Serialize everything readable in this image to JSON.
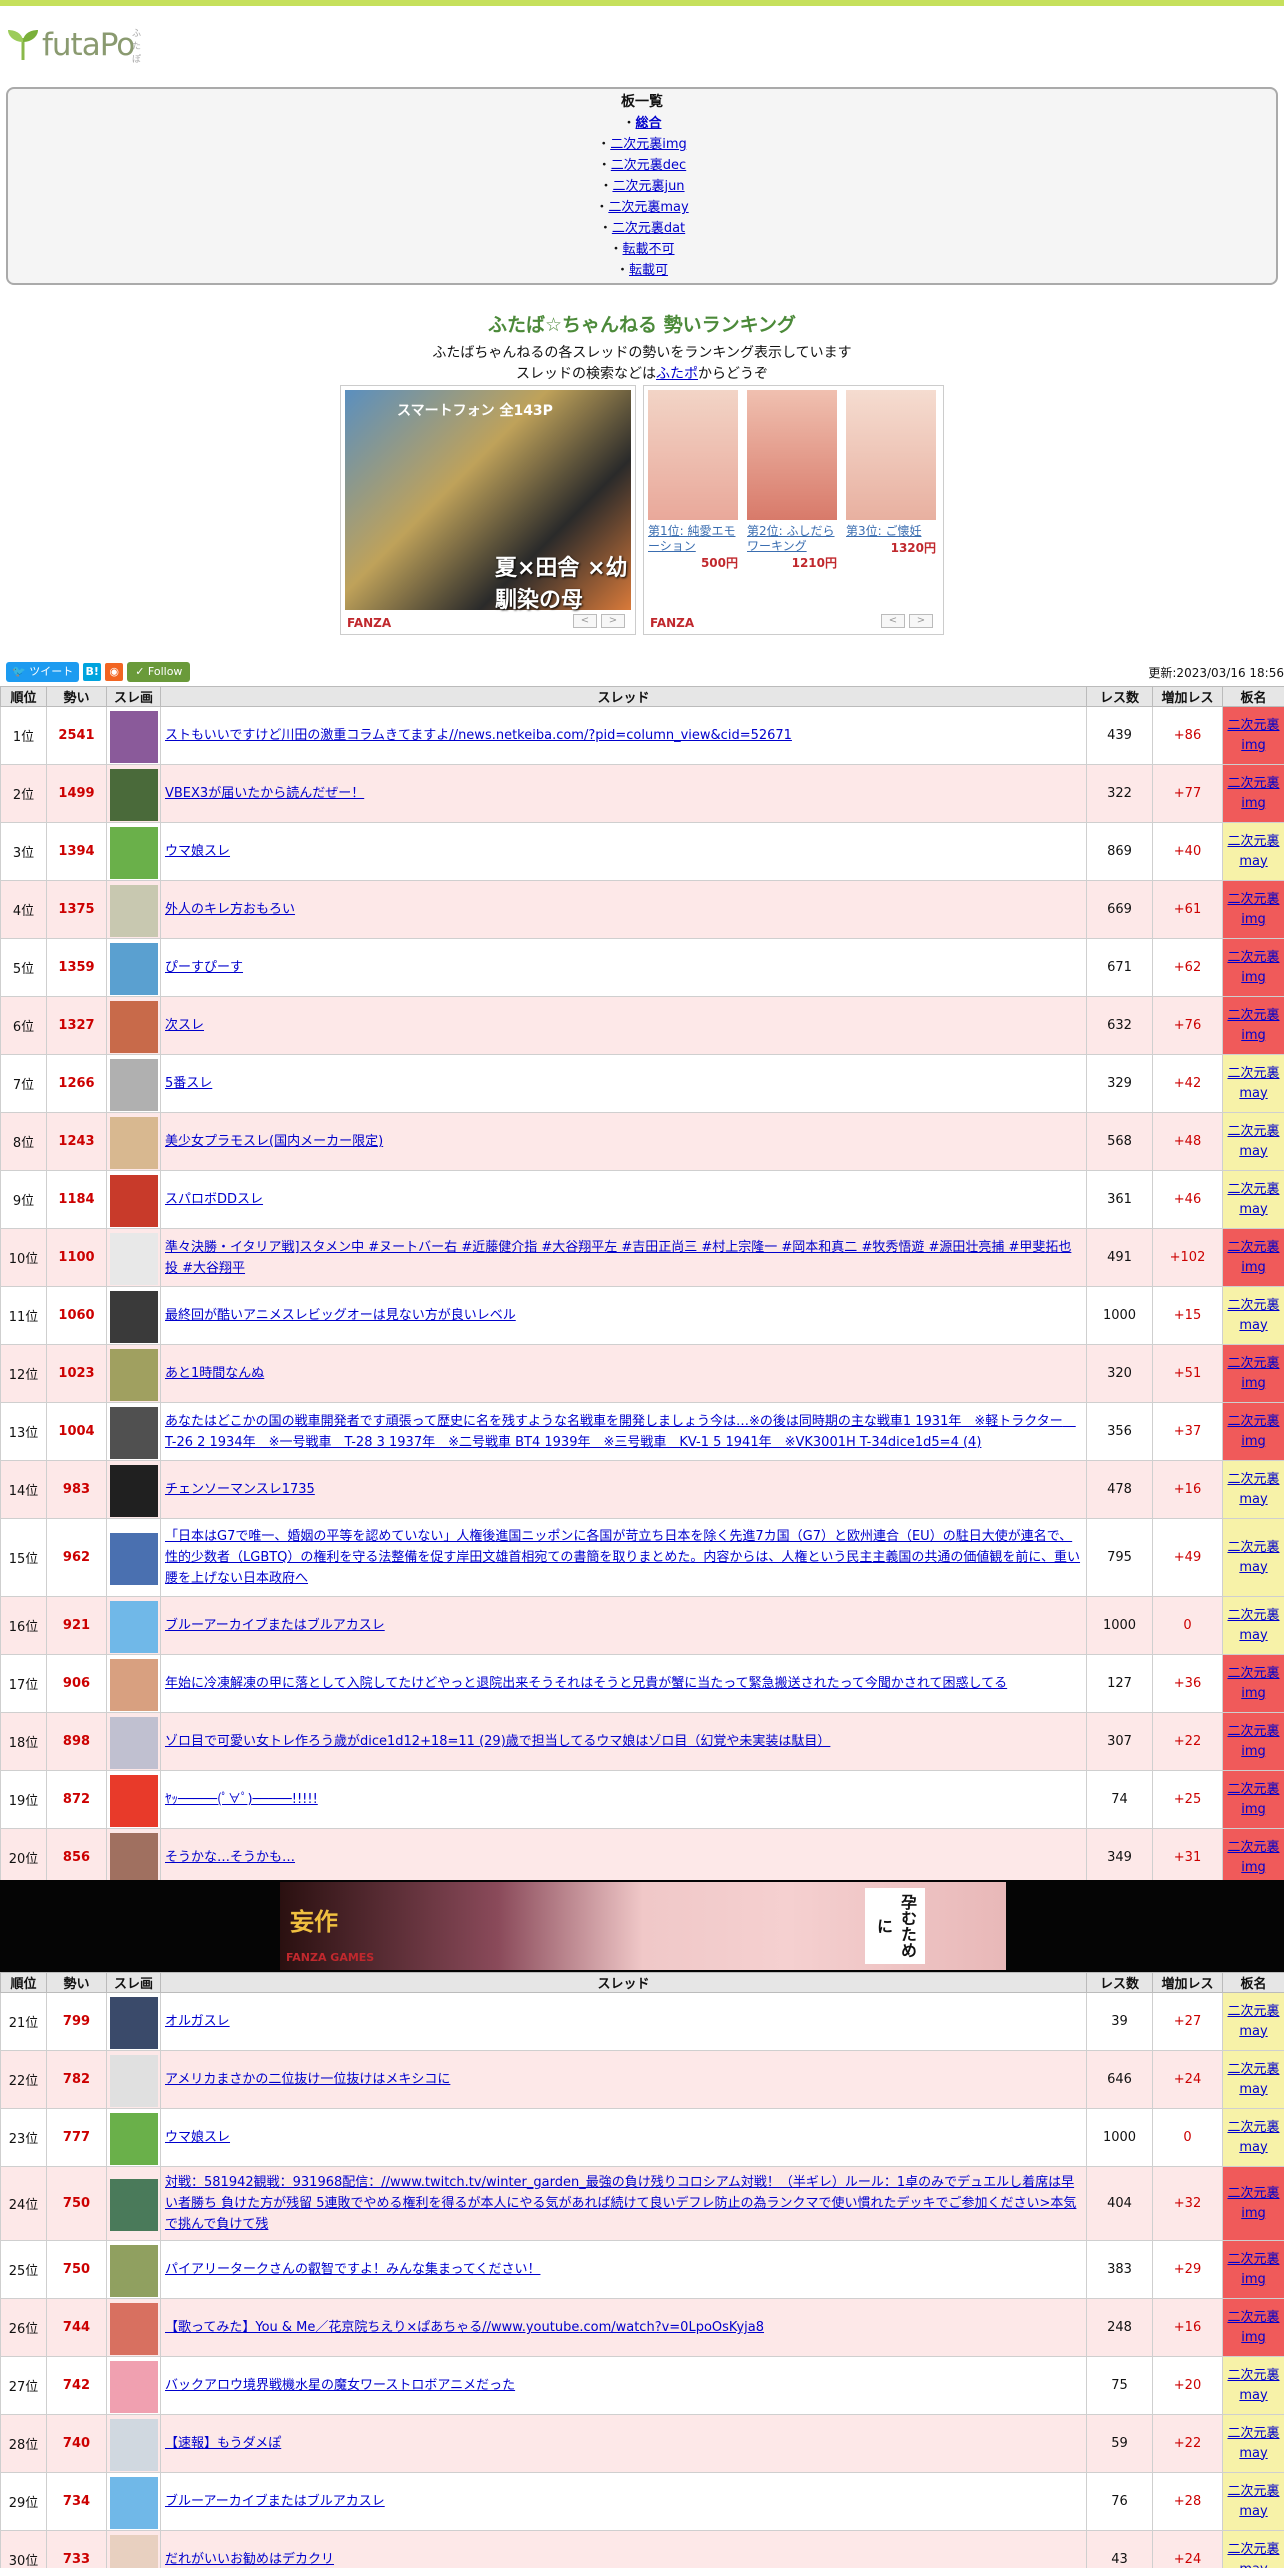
{
  "logo": {
    "text": "futaPo",
    "ruby": "ふたぽ"
  },
  "boards": {
    "title": "板一覧",
    "items": [
      {
        "label": "総合"
      },
      {
        "label": "二次元裏img"
      },
      {
        "label": "二次元裏dec"
      },
      {
        "label": "二次元裏jun"
      },
      {
        "label": "二次元裏may"
      },
      {
        "label": "二次元裏dat"
      },
      {
        "label": "転載不可"
      },
      {
        "label": "転載可"
      }
    ]
  },
  "heading": {
    "title": "ふたば☆ちゃんねる 勢いランキング",
    "line1": "ふたばちゃんねるの各スレッドの勢いをランキング表示しています",
    "line2_pre": "スレッドの検索などは",
    "line2_link": "ふたポ",
    "line2_post": "からどうぞ"
  },
  "ad1": {
    "banner_top": "スマートフォン 全143P",
    "banner_text": "夏×田舎 ×幼馴染の母",
    "brand": "FANZA",
    "prev": "<",
    "next": ">"
  },
  "ad2": {
    "brand": "FANZA",
    "prev": "<",
    "next": ">",
    "products": [
      {
        "name": "第1位: 純愛エモーション",
        "price": "500円"
      },
      {
        "name": "第2位: ふしだらワーキング",
        "price": "1210円"
      },
      {
        "name": "第3位: ご懐妊",
        "price": "1320円"
      }
    ]
  },
  "social": {
    "tweet": "ツイート",
    "hatena": "B!",
    "rss": "RSS",
    "follow": "Follow"
  },
  "updated": "更新:2023/03/16 18:56",
  "table_headers": {
    "rank": "順位",
    "ikioi": "勢い",
    "img": "スレ画",
    "thread": "スレッド",
    "res": "レス数",
    "add": "増加レス",
    "board": "板名"
  },
  "rows1": [
    {
      "rank": "1位",
      "ikioi": "2541",
      "thread": "ストもいいですけど川田の激重コラムきてますよ//news.netkeiba.com/?pid=column_view&cid=52671",
      "res": "439",
      "add": "+86",
      "board1": "二次元裏",
      "board2": "img",
      "color": "#8a5a9a"
    },
    {
      "rank": "2位",
      "ikioi": "1499",
      "thread": "VBEX3が届いたから読んだぜー！",
      "res": "322",
      "add": "+77",
      "board1": "二次元裏",
      "board2": "img",
      "color": "#4a6a3a"
    },
    {
      "rank": "3位",
      "ikioi": "1394",
      "thread": "ウマ娘スレ",
      "res": "869",
      "add": "+40",
      "board1": "二次元裏",
      "board2": "may",
      "color": "#6ab04a"
    },
    {
      "rank": "4位",
      "ikioi": "1375",
      "thread": "外人のキレ方おもろい",
      "res": "669",
      "add": "+61",
      "board1": "二次元裏",
      "board2": "img",
      "color": "#c8c8b0"
    },
    {
      "rank": "5位",
      "ikioi": "1359",
      "thread": "ぴーすぴーす",
      "res": "671",
      "add": "+62",
      "board1": "二次元裏",
      "board2": "img",
      "color": "#5aa0d0"
    },
    {
      "rank": "6位",
      "ikioi": "1327",
      "thread": "次スレ",
      "res": "632",
      "add": "+76",
      "board1": "二次元裏",
      "board2": "img",
      "color": "#c86a4a"
    },
    {
      "rank": "7位",
      "ikioi": "1266",
      "thread": "5番スレ",
      "res": "329",
      "add": "+42",
      "board1": "二次元裏",
      "board2": "may",
      "color": "#b0b0b0"
    },
    {
      "rank": "8位",
      "ikioi": "1243",
      "thread": "美少女プラモスレ(国内メーカー限定)",
      "res": "568",
      "add": "+48",
      "board1": "二次元裏",
      "board2": "may",
      "color": "#d8b890"
    },
    {
      "rank": "9位",
      "ikioi": "1184",
      "thread": "スパロボDDスレ",
      "res": "361",
      "add": "+46",
      "board1": "二次元裏",
      "board2": "may",
      "color": "#c83a2a"
    },
    {
      "rank": "10位",
      "ikioi": "1100",
      "thread": "準々決勝・イタリア戦]スタメン中 #ヌートバー右 #近藤健介指 #大谷翔平左 #吉田正尚三 #村上宗隆一 #岡本和真二 #牧秀悟遊 #源田壮亮捕 #甲斐拓也投 #大谷翔平",
      "res": "491",
      "add": "+102",
      "board1": "二次元裏",
      "board2": "img",
      "color": "#e8e8e8"
    },
    {
      "rank": "11位",
      "ikioi": "1060",
      "thread": "最終回が酷いアニメスレビッグオーは見ない方が良いレベル",
      "res": "1000",
      "add": "+15",
      "board1": "二次元裏",
      "board2": "may",
      "color": "#3a3a3a"
    },
    {
      "rank": "12位",
      "ikioi": "1023",
      "thread": "あと1時間なんぬ",
      "res": "320",
      "add": "+51",
      "board1": "二次元裏",
      "board2": "img",
      "color": "#a0a060"
    },
    {
      "rank": "13位",
      "ikioi": "1004",
      "thread": "あなたはどこかの国の戦車開発者です頑張って歴史に名を残すような名戦車を開発しましょう今は…※の後は同時期の主な戦車1 1931年　※軽トラクター　T-26 2 1934年　※一号戦車　T-28 3 1937年　※二号戦車 BT4 1939年　※三号戦車　KV-1 5 1941年　※VK3001H T-34dice1d5=4 (4)",
      "res": "356",
      "add": "+37",
      "board1": "二次元裏",
      "board2": "img",
      "color": "#505050"
    },
    {
      "rank": "14位",
      "ikioi": "983",
      "thread": "チェンソーマンスレ1735",
      "res": "478",
      "add": "+16",
      "board1": "二次元裏",
      "board2": "may",
      "color": "#202020"
    },
    {
      "rank": "15位",
      "ikioi": "962",
      "thread": "「日本はG7で唯一、婚姻の平等を認めていない」人権後進国ニッポンに各国が苛立ち日本を除く先進7カ国（G7）と欧州連合（EU）の駐日大使が連名で、性的少数者（LGBTQ）の権利を守る法整備を促す岸田文雄首相宛ての書簡を取りまとめた。内容からは、人権という民主主義国の共通の価値観を前に、重い腰を上げない日本政府へ",
      "res": "795",
      "add": "+49",
      "board1": "二次元裏",
      "board2": "may",
      "color": "#4a70b0"
    },
    {
      "rank": "16位",
      "ikioi": "921",
      "thread": "ブルーアーカイブまたはブルアカスレ",
      "res": "1000",
      "add": "0",
      "board1": "二次元裏",
      "board2": "may",
      "color": "#70b8e8"
    },
    {
      "rank": "17位",
      "ikioi": "906",
      "thread": "年始に冷凍解凍の甲に落として入院してたけどやっと退院出来そうそれはそうと兄貴が蟹に当たって緊急搬送されたって今聞かされて困惑してる",
      "res": "127",
      "add": "+36",
      "board1": "二次元裏",
      "board2": "img",
      "color": "#d8a080"
    },
    {
      "rank": "18位",
      "ikioi": "898",
      "thread": "ゾロ目で可愛い女トレ作ろう歳がdice1d12+18=11 (29)歳で担当してるウマ娘はゾロ目（幻覚や未実装は駄目）",
      "res": "307",
      "add": "+22",
      "board1": "二次元裏",
      "board2": "img",
      "color": "#c0c0d0"
    },
    {
      "rank": "19位",
      "ikioi": "872",
      "thread": "ﾔｯ─────(ﾟ∀ﾟ)─────!!!!!",
      "res": "74",
      "add": "+25",
      "board1": "二次元裏",
      "board2": "img",
      "color": "#e83a2a"
    },
    {
      "rank": "20位",
      "ikioi": "856",
      "thread": "そうかな…そうかも…",
      "res": "349",
      "add": "+31",
      "board1": "二次元裏",
      "board2": "img",
      "color": "#a07060"
    }
  ],
  "banner2": {
    "logo": "妄作",
    "sub": "FANZA GAMES",
    "vert": "孕むために"
  },
  "rows2": [
    {
      "rank": "21位",
      "ikioi": "799",
      "thread": "オルガスレ",
      "res": "39",
      "add": "+27",
      "board1": "二次元裏",
      "board2": "may",
      "color": "#3a4a6a"
    },
    {
      "rank": "22位",
      "ikioi": "782",
      "thread": "アメリカまさかの二位抜け一位抜けはメキシコに",
      "res": "646",
      "add": "+24",
      "board1": "二次元裏",
      "board2": "may",
      "color": "#e0e0e0"
    },
    {
      "rank": "23位",
      "ikioi": "777",
      "thread": "ウマ娘スレ",
      "res": "1000",
      "add": "0",
      "board1": "二次元裏",
      "board2": "may",
      "color": "#6ab04a"
    },
    {
      "rank": "24位",
      "ikioi": "750",
      "thread": "対戦：581942観戦：931968配信：//www.twitch.tv/winter_garden_最強の負け残りコロシアム対戦！（半ギレ）ルール：1卓のみでデュエルし着席は早い者勝ち 負けた方が残留 5連敗でやめる権利を得るが本人にやる気があれば続けて良いデフレ防止の為ランクマで使い慣れたデッキでご参加ください>本気で挑んで負けて残",
      "res": "404",
      "add": "+32",
      "board1": "二次元裏",
      "board2": "img",
      "color": "#4a7a5a"
    },
    {
      "rank": "25位",
      "ikioi": "750",
      "thread": "パイアリータークさんの叡智ですよ！みんな集まってください！",
      "res": "383",
      "add": "+29",
      "board1": "二次元裏",
      "board2": "img",
      "color": "#90a060"
    },
    {
      "rank": "26位",
      "ikioi": "744",
      "thread": "【歌ってみた】You & Me／花京院ちえり×ぱあちゃる//www.youtube.com/watch?v=0LpoOsKyja8",
      "res": "248",
      "add": "+16",
      "board1": "二次元裏",
      "board2": "img",
      "color": "#d87060"
    },
    {
      "rank": "27位",
      "ikioi": "742",
      "thread": "バックアロウ境界戦機水星の魔女ワーストロボアニメだった",
      "res": "75",
      "add": "+20",
      "board1": "二次元裏",
      "board2": "may",
      "color": "#f0a0b0"
    },
    {
      "rank": "28位",
      "ikioi": "740",
      "thread": "【速報】もうダメぽ",
      "res": "59",
      "add": "+22",
      "board1": "二次元裏",
      "board2": "may",
      "color": "#d0d8e0"
    },
    {
      "rank": "29位",
      "ikioi": "734",
      "thread": "ブルーアーカイブまたはブルアカスレ",
      "res": "76",
      "add": "+28",
      "board1": "二次元裏",
      "board2": "may",
      "color": "#70b8e8"
    },
    {
      "rank": "30位",
      "ikioi": "733",
      "thread": "だれがいいお勧めはデカクリ",
      "res": "43",
      "add": "+24",
      "board1": "二次元裏",
      "board2": "may",
      "color": "#e8d0c0"
    }
  ]
}
